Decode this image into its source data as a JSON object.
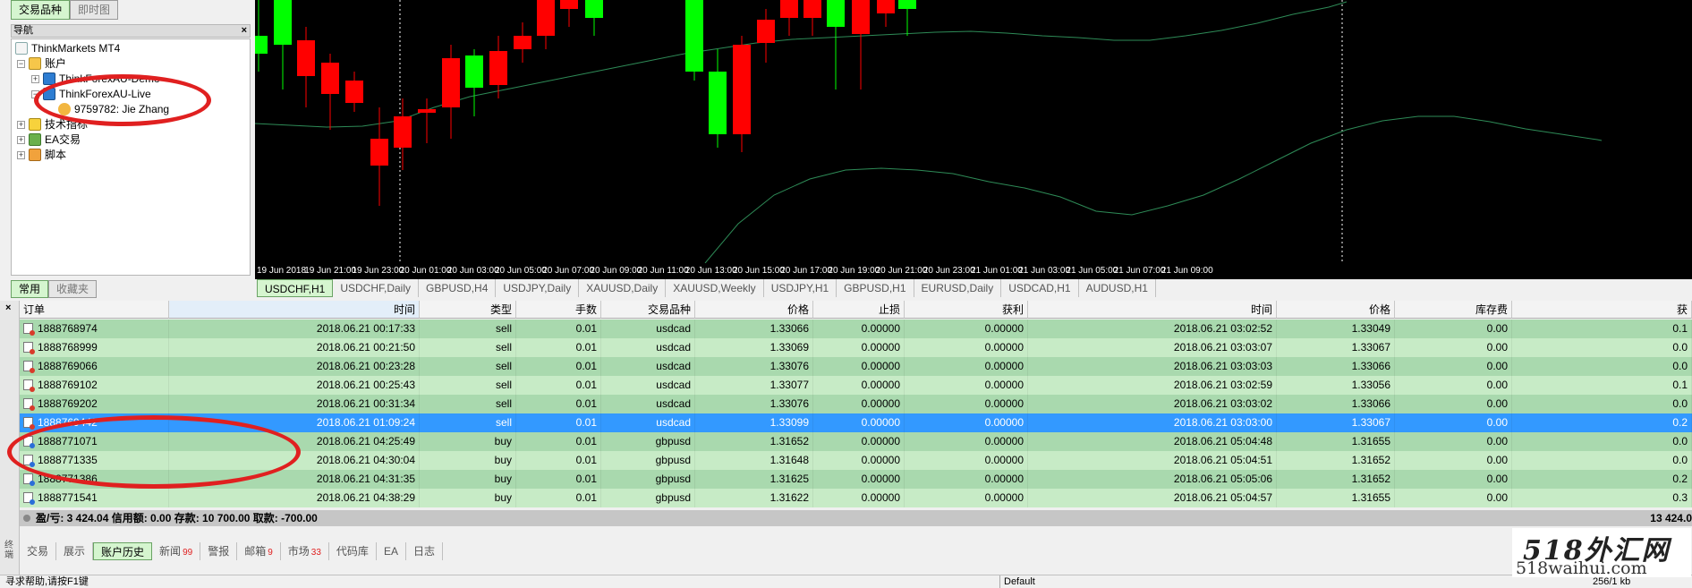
{
  "left_panel": {
    "top_tabs": [
      "交易品种",
      "即时图"
    ],
    "navigator_title": "导航",
    "close_glyph": "×",
    "tree": {
      "root": "ThinkMarkets MT4",
      "accounts": "账户",
      "demo_server": "ThinkForexAU-Demo",
      "live_server": "ThinkForexAU-Live",
      "user": "9759782: Jie Zhang",
      "indicators": "技术指标",
      "ea": "EA交易",
      "scripts": "脚本"
    },
    "bottom_tabs": [
      "常用",
      "收藏夹"
    ]
  },
  "chart": {
    "x_ticks": [
      "19 Jun 2018",
      "19 Jun 21:00",
      "19 Jun 23:00",
      "20 Jun 01:00",
      "20 Jun 03:00",
      "20 Jun 05:00",
      "20 Jun 07:00",
      "20 Jun 09:00",
      "20 Jun 11:00",
      "20 Jun 13:00",
      "20 Jun 15:00",
      "20 Jun 17:00",
      "20 Jun 19:00",
      "20 Jun 21:00",
      "20 Jun 23:00",
      "21 Jun 01:00",
      "21 Jun 03:00",
      "21 Jun 05:00",
      "21 Jun 07:00",
      "21 Jun 09:00"
    ],
    "colors": {
      "up": "#00ff00",
      "down": "#ff0000",
      "band": "#2e8b57",
      "background": "#000000"
    }
  },
  "chart_tabs": [
    "USDCHF,H1",
    "USDCHF,Daily",
    "GBPUSD,H4",
    "USDJPY,Daily",
    "XAUUSD,Daily",
    "XAUUSD,Weekly",
    "USDJPY,H1",
    "GBPUSD,H1",
    "EURUSD,Daily",
    "USDCAD,H1",
    "AUDUSD,H1"
  ],
  "terminal": {
    "close_glyph": "×",
    "side_label": "终端",
    "columns": [
      "订单",
      "时间",
      "类型",
      "手数",
      "交易品种",
      "价格",
      "止损",
      "获利",
      "时间",
      "价格",
      "库存费",
      "获"
    ],
    "rows": [
      {
        "order": "1888768974",
        "open_time": "2018.06.21 00:17:33",
        "type": "sell",
        "lots": "0.01",
        "symbol": "usdcad",
        "open_price": "1.33066",
        "sl": "0.00000",
        "tp": "0.00000",
        "close_time": "2018.06.21 03:02:52",
        "close_price": "1.33049",
        "swap": "0.00",
        "profit": "0.1"
      },
      {
        "order": "1888768999",
        "open_time": "2018.06.21 00:21:50",
        "type": "sell",
        "lots": "0.01",
        "symbol": "usdcad",
        "open_price": "1.33069",
        "sl": "0.00000",
        "tp": "0.00000",
        "close_time": "2018.06.21 03:03:07",
        "close_price": "1.33067",
        "swap": "0.00",
        "profit": "0.0"
      },
      {
        "order": "1888769066",
        "open_time": "2018.06.21 00:23:28",
        "type": "sell",
        "lots": "0.01",
        "symbol": "usdcad",
        "open_price": "1.33076",
        "sl": "0.00000",
        "tp": "0.00000",
        "close_time": "2018.06.21 03:03:03",
        "close_price": "1.33066",
        "swap": "0.00",
        "profit": "0.0"
      },
      {
        "order": "1888769102",
        "open_time": "2018.06.21 00:25:43",
        "type": "sell",
        "lots": "0.01",
        "symbol": "usdcad",
        "open_price": "1.33077",
        "sl": "0.00000",
        "tp": "0.00000",
        "close_time": "2018.06.21 03:02:59",
        "close_price": "1.33056",
        "swap": "0.00",
        "profit": "0.1"
      },
      {
        "order": "1888769202",
        "open_time": "2018.06.21 00:31:34",
        "type": "sell",
        "lots": "0.01",
        "symbol": "usdcad",
        "open_price": "1.33076",
        "sl": "0.00000",
        "tp": "0.00000",
        "close_time": "2018.06.21 03:03:02",
        "close_price": "1.33066",
        "swap": "0.00",
        "profit": "0.0"
      },
      {
        "order": "1888769442",
        "open_time": "2018.06.21 01:09:24",
        "type": "sell",
        "lots": "0.01",
        "symbol": "usdcad",
        "open_price": "1.33099",
        "sl": "0.00000",
        "tp": "0.00000",
        "close_time": "2018.06.21 03:03:00",
        "close_price": "1.33067",
        "swap": "0.00",
        "profit": "0.2",
        "selected": true
      },
      {
        "order": "1888771071",
        "open_time": "2018.06.21 04:25:49",
        "type": "buy",
        "lots": "0.01",
        "symbol": "gbpusd",
        "open_price": "1.31652",
        "sl": "0.00000",
        "tp": "0.00000",
        "close_time": "2018.06.21 05:04:48",
        "close_price": "1.31655",
        "swap": "0.00",
        "profit": "0.0"
      },
      {
        "order": "1888771335",
        "open_time": "2018.06.21 04:30:04",
        "type": "buy",
        "lots": "0.01",
        "symbol": "gbpusd",
        "open_price": "1.31648",
        "sl": "0.00000",
        "tp": "0.00000",
        "close_time": "2018.06.21 05:04:51",
        "close_price": "1.31652",
        "swap": "0.00",
        "profit": "0.0"
      },
      {
        "order": "1888771386",
        "open_time": "2018.06.21 04:31:35",
        "type": "buy",
        "lots": "0.01",
        "symbol": "gbpusd",
        "open_price": "1.31625",
        "sl": "0.00000",
        "tp": "0.00000",
        "close_time": "2018.06.21 05:05:06",
        "close_price": "1.31652",
        "swap": "0.00",
        "profit": "0.2"
      },
      {
        "order": "1888771541",
        "open_time": "2018.06.21 04:38:29",
        "type": "buy",
        "lots": "0.01",
        "symbol": "gbpusd",
        "open_price": "1.31622",
        "sl": "0.00000",
        "tp": "0.00000",
        "close_time": "2018.06.21 05:04:57",
        "close_price": "1.31655",
        "swap": "0.00",
        "profit": "0.3"
      }
    ],
    "summary": "盈/亏: 3 424.04  信用额: 0.00  存款: 10 700.00  取款: -700.00",
    "summary_total": "13 424.0",
    "tabs": [
      {
        "label": "交易",
        "badge": ""
      },
      {
        "label": "展示",
        "badge": ""
      },
      {
        "label": "账户历史",
        "badge": ""
      },
      {
        "label": "新闻",
        "badge": "99"
      },
      {
        "label": "警报",
        "badge": ""
      },
      {
        "label": "邮箱",
        "badge": "9"
      },
      {
        "label": "市场",
        "badge": "33"
      },
      {
        "label": "代码库",
        "badge": ""
      },
      {
        "label": "EA",
        "badge": ""
      },
      {
        "label": "日志",
        "badge": ""
      }
    ],
    "active_tab": "账户历史",
    "row_colors": {
      "odd": "#a9d9ae",
      "even": "#c7ebc6",
      "selected": "#3399ff"
    }
  },
  "status_bar": {
    "help": "寻求帮助,请按F1键",
    "profile": "Default",
    "traffic": "256/1 kb"
  },
  "watermark": {
    "line1": "518外汇网",
    "line2": "518waihui.com"
  }
}
